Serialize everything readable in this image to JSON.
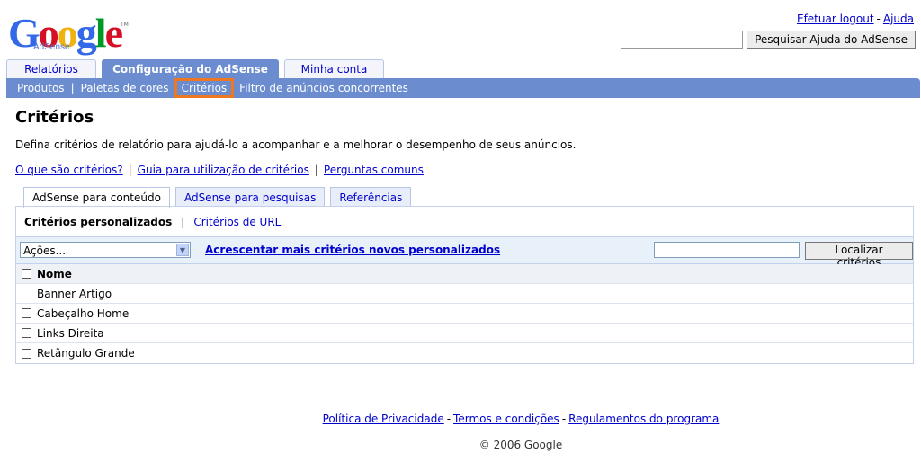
{
  "logo": {
    "text": "Google",
    "sub": "AdSense",
    "tm": "TM"
  },
  "toplinks": {
    "logout": "Efetuar logout",
    "sep": "-",
    "help": "Ajuda"
  },
  "search_top": {
    "button": "Pesquisar Ajuda do AdSense",
    "value": ""
  },
  "main_tabs": [
    {
      "label": "Relatórios"
    },
    {
      "label": "Configuração do AdSense"
    },
    {
      "label": "Minha conta"
    }
  ],
  "subnav": [
    {
      "label": "Produtos"
    },
    {
      "label": "Paletas de cores"
    },
    {
      "label": "Critérios"
    },
    {
      "label": "Filtro de anúncios concorrentes"
    }
  ],
  "separator": "|",
  "page": {
    "title": "Critérios",
    "description": "Defina critérios de relatório para ajudá-lo a acompanhar e a melhorar o desempenho de seus anúncios.",
    "links": [
      {
        "label": "O que são critérios?"
      },
      {
        "label": "Guia para utilização de critérios"
      },
      {
        "label": "Perguntas comuns"
      }
    ]
  },
  "sub_tabs": [
    {
      "label": "AdSense para conteúdo"
    },
    {
      "label": "AdSense para pesquisas"
    },
    {
      "label": "Referências"
    }
  ],
  "criteria_nav": {
    "custom": "Critérios personalizados",
    "url": "Critérios de URL"
  },
  "actions": {
    "select_value": "Ações...",
    "add_link": "Acrescentar mais critérios novos personalizados",
    "find_button": "Localizar critérios",
    "find_value": ""
  },
  "table": {
    "header": "Nome",
    "rows": [
      "Banner Artigo",
      "Cabeçalho Home",
      "Links Direita",
      "Retângulo Grande"
    ]
  },
  "footer": {
    "links": [
      "Política de Privacidade",
      "Termos e condições",
      "Regulamentos do programa"
    ],
    "sep": "-",
    "copyright": "© 2006 Google"
  },
  "colors": {
    "accent": "#6b8dd0",
    "highlight": "#ee7722",
    "link": "#0000cc"
  }
}
